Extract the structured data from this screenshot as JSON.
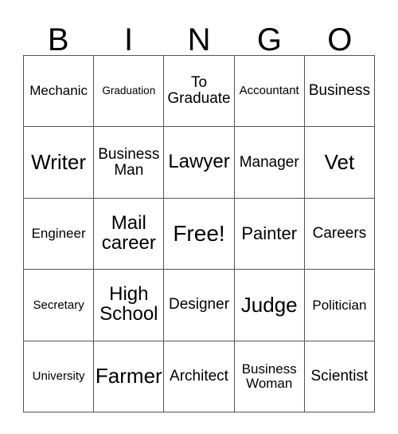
{
  "card": {
    "header": {
      "letters": [
        "B",
        "I",
        "N",
        "G",
        "O"
      ]
    },
    "rows": [
      [
        {
          "text": "Mechanic",
          "size": "fs-md"
        },
        {
          "text": "Graduation",
          "size": "fs-xs"
        },
        {
          "text": "To Graduate",
          "size": "fs-lg"
        },
        {
          "text": "Accountant",
          "size": "fs-sm"
        },
        {
          "text": "Business",
          "size": "fs-lg"
        }
      ],
      [
        {
          "text": "Writer",
          "size": "fs-3xl"
        },
        {
          "text": "Business Man",
          "size": "fs-lg"
        },
        {
          "text": "Lawyer",
          "size": "fs-2xl"
        },
        {
          "text": "Manager",
          "size": "fs-lg"
        },
        {
          "text": "Vet",
          "size": "fs-3xl"
        }
      ],
      [
        {
          "text": "Engineer",
          "size": "fs-md"
        },
        {
          "text": "Mail career",
          "size": "fs-2xl"
        },
        {
          "text": "Free!",
          "size": "fs-4xl"
        },
        {
          "text": "Painter",
          "size": "fs-xl"
        },
        {
          "text": "Careers",
          "size": "fs-lg"
        }
      ],
      [
        {
          "text": "Secretary",
          "size": "fs-sm"
        },
        {
          "text": "High School",
          "size": "fs-2xl"
        },
        {
          "text": "Designer",
          "size": "fs-lg"
        },
        {
          "text": "Judge",
          "size": "fs-3xl"
        },
        {
          "text": "Politician",
          "size": "fs-md"
        }
      ],
      [
        {
          "text": "University",
          "size": "fs-sm"
        },
        {
          "text": "Farmer",
          "size": "fs-3xl"
        },
        {
          "text": "Architect",
          "size": "fs-lg"
        },
        {
          "text": "Business Woman",
          "size": "fs-md"
        },
        {
          "text": "Scientist",
          "size": "fs-lg"
        }
      ]
    ]
  },
  "colors": {
    "border": "#555555",
    "background": "#ffffff",
    "text": "#000000"
  }
}
